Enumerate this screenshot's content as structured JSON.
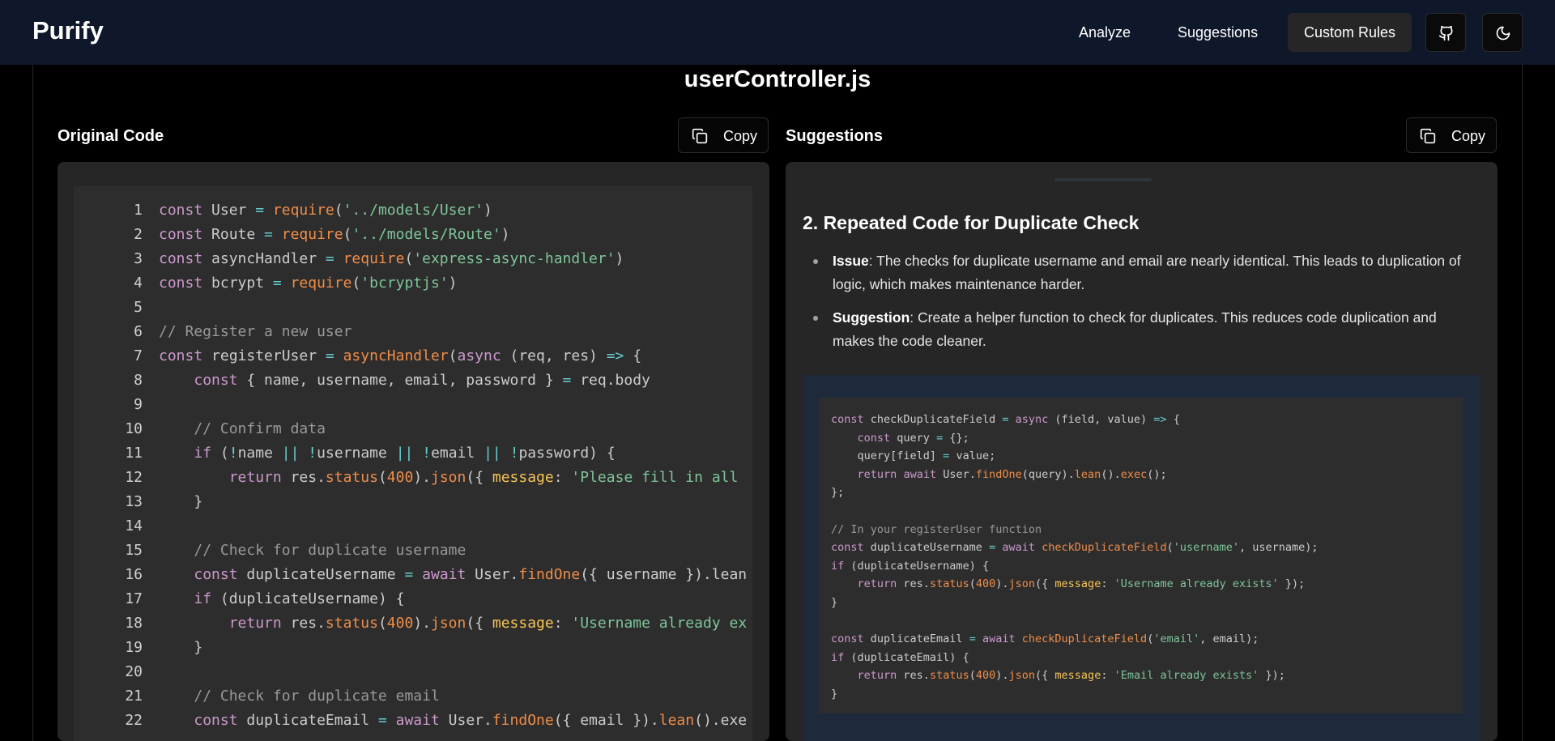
{
  "nav": {
    "brand": "Purify",
    "items": [
      {
        "label": "Analyze"
      },
      {
        "label": "Suggestions"
      },
      {
        "label": "Custom Rules"
      }
    ]
  },
  "file_title": "userController.js",
  "left_panel": {
    "title": "Original Code",
    "copy_label": "Copy"
  },
  "right_panel": {
    "title": "Suggestions",
    "copy_label": "Copy"
  },
  "code_lines": [
    "const User = require('../models/User')",
    "const Route = require('../models/Route')",
    "const asyncHandler = require('express-async-handler')",
    "const bcrypt = require('bcryptjs')",
    "",
    "// Register a new user",
    "const registerUser = asyncHandler(async (req, res) => {",
    "    const { name, username, email, password } = req.body",
    "",
    "    // Confirm data",
    "    if (!name || !username || !email || !password) {",
    "        return res.status(400).json({ message: 'Please fill in all",
    "    }",
    "",
    "    // Check for duplicate username",
    "    const duplicateUsername = await User.findOne({ username }).lean",
    "    if (duplicateUsername) {",
    "        return res.status(400).json({ message: 'Username already ex",
    "    }",
    "",
    "    // Check for duplicate email",
    "    const duplicateEmail = await User.findOne({ email }).lean().exe"
  ],
  "suggestion": {
    "heading": "2. Repeated Code for Duplicate Check",
    "issue_label": "Issue",
    "issue_text": ": The checks for duplicate username and email are nearly identical. This leads to duplication of logic, which makes maintenance harder.",
    "suggestion_label": "Suggestion",
    "suggestion_text": ": Create a helper function to check for duplicates. This reduces code duplication and makes the code cleaner.",
    "snippet_lines": [
      "const checkDuplicateField = async (field, value) => {",
      "    const query = {};",
      "    query[field] = value;",
      "    return await User.findOne(query).lean().exec();",
      "};",
      "",
      "// In your registerUser function",
      "const duplicateUsername = await checkDuplicateField('username', username);",
      "if (duplicateUsername) {",
      "    return res.status(400).json({ message: 'Username already exists' });",
      "}",
      "",
      "const duplicateEmail = await checkDuplicateField('email', email);",
      "if (duplicateEmail) {",
      "    return res.status(400).json({ message: 'Email already exists' });",
      "}"
    ]
  },
  "colors": {
    "nav_bg": "#0f172a",
    "panel_bg": "#262626",
    "code_bg": "#2d2d2d",
    "snippet_outer_bg": "#1e293b"
  }
}
